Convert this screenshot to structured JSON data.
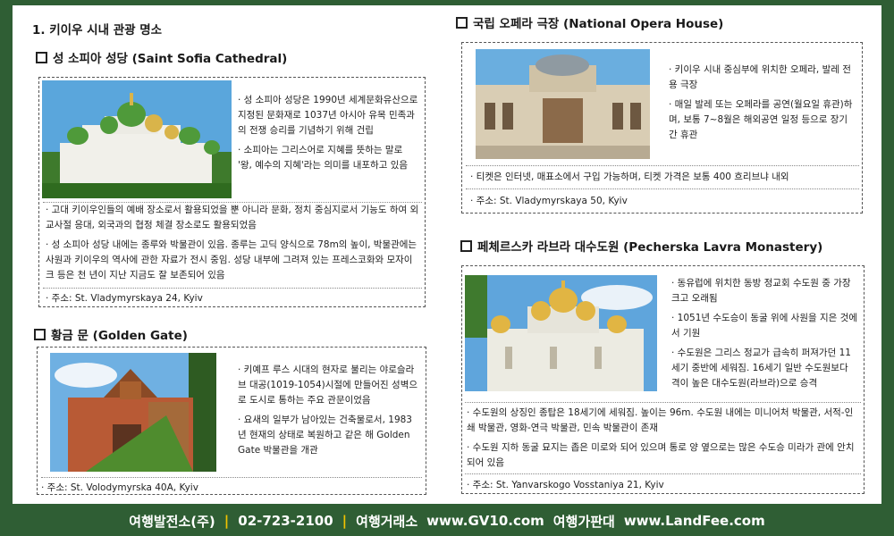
{
  "doc_title": "1. 키이우 시내 관광 명소",
  "sofia": {
    "heading": "성 소피아 성당 (Saint Sofia Cathedral)",
    "side_bullets": [
      "· 성 소피아 성당은 1990년 세계문화유산으로 지정된 문화재로 1037년 아시아 유목 민족과의 전쟁 승리를 기념하기 위해 건립",
      "· 소피아는 그리스어로 지혜를 뜻하는 말로 '왕, 예수의 지혜'라는 의미를 내포하고 있음"
    ],
    "full_bullets": [
      "· 고대 키이우인들의 예배 장소로서 활용되었을 뿐 아니라 문화, 정치 중심지로서 기능도 하여 외교사절 응대, 외국과의 협정 체결 장소로도 활용되었음",
      "· 성 소피아 성당 내에는 종루와 박물관이 있음. 종루는 고딕 양식으로 78m의 높이, 박물관에는 사원과 키이우의 역사에 관한 자료가 전시 중임. 성당 내부에 그려져 있는 프레스코화와 모자이크 등은 천 년이 지난 지금도 잘 보존되어 있음"
    ],
    "address": "· 주소: St. Vladymyrskaya 24, Kyiv"
  },
  "golden": {
    "heading": "황금 문 (Golden Gate)",
    "side_bullets": [
      "· 키예프 루스 시대의 현자로 불리는 야로슬라브 대공(1019-1054)시절에 만들어진 성벽으로 도시로 통하는 주요 관문이었음",
      "· 요새의 일부가 남아있는 건축물로서, 1983년 현재의 상태로 복원하고 같은 해 Golden Gate 박물관을 개관"
    ],
    "address": "· 주소: St. Volodymyrska 40A, Kyiv"
  },
  "opera": {
    "heading": "국립 오페라 극장 (National Opera House)",
    "side_bullets": [
      "· 키이우 시내 중심부에 위치한 오페라, 발레 전용 극장",
      "· 매일 발레 또는 오페라를 공연(월요일 휴관)하며, 보통 7~8월은 해외공연 일정 등으로 장기간 휴관"
    ],
    "full_bullets": [
      "· 티켓은 인터넷, 매표소에서 구입 가능하며, 티켓 가격은 보통 400 흐리브냐 내외"
    ],
    "address": "· 주소: St. Vladymyrskaya 50, Kyiv"
  },
  "lavra": {
    "heading": "페체르스카 라브라 대수도원 (Pecherska Lavra Monastery)",
    "side_bullets": [
      "· 동유럽에 위치한 동방 정교회 수도원 중 가장 크고 오래됨",
      "· 1051년 수도승이 동굴 위에 사원을 지은 것에서 기원",
      "· 수도원은 그리스 정교가 급속히 퍼져가던 11세기 중반에 세워짐. 16세기 일반 수도원보다 격이 높은 대수도원(라브라)으로 승격"
    ],
    "full_bullets": [
      "· 수도원의 상징인 종탑은 18세기에 세워짐. 높이는 96m. 수도원 내에는 미니어처 박물관, 서적-인쇄 박물관, 영화-연극 박물관, 민속 박물관이 존재",
      "· 수도원 지하 동굴 묘지는 좁은 미로와 되어 있으며 통로 양 옆으로는 많은 수도승 미라가 관에 안치되어 있음"
    ],
    "address": "· 주소: St. Yanvarskogo Vosstaniya 21, Kyiv"
  },
  "footer": {
    "company": "여행발전소(주)",
    "phone": "02-723-2100",
    "site1_label": "여행거래소",
    "site1_url": "www.GV10.com",
    "site2_label": "여행가판대",
    "site2_url": "www.LandFee.com",
    "separator": "|"
  },
  "colors": {
    "background": "#2f5e34",
    "footer_separator": "#f2c200"
  }
}
